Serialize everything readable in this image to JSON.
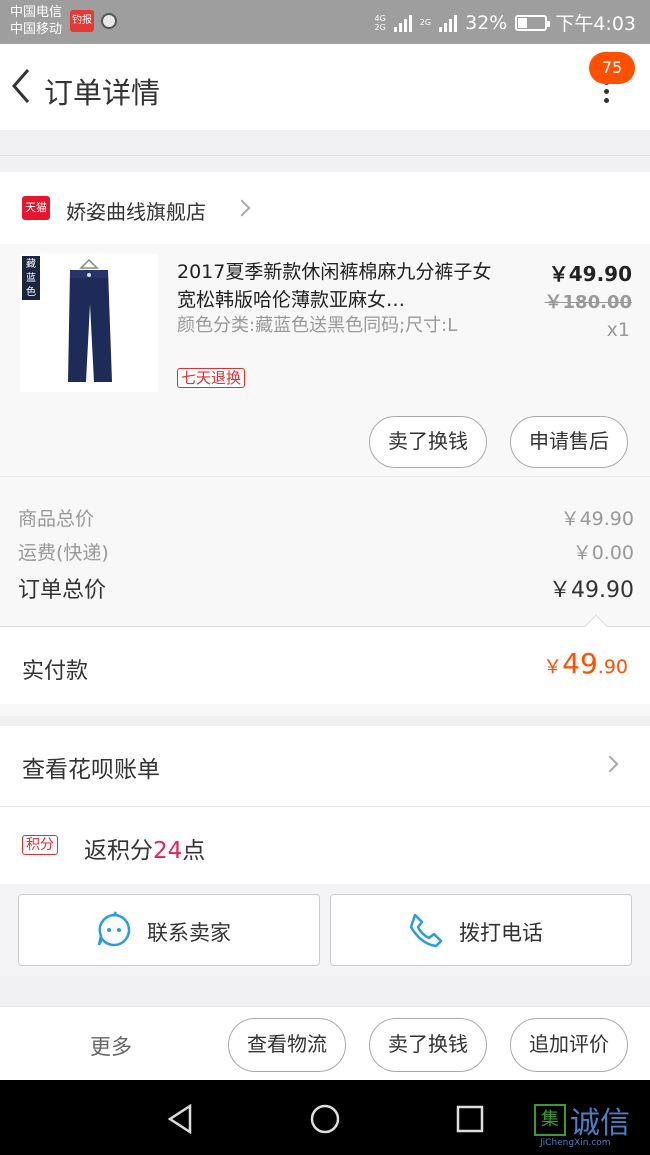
{
  "status_bar": {
    "carrier1": "中国电信",
    "carrier2": "中国移动",
    "app_icon_text": "钓报",
    "sig1_label_top": "4G",
    "sig1_label_bottom": "2G",
    "sig2_label": "2G",
    "battery": "32%",
    "time": "下午4:03"
  },
  "header": {
    "title": "订单详情",
    "badge": "75"
  },
  "shop": {
    "badge_text": "天猫",
    "name": "娇姿曲线旗舰店"
  },
  "item": {
    "image_tag": "藏蓝色",
    "title": "2017夏季新款休闲裤棉麻九分裤子女宽松韩版哈伦薄款亚麻女…",
    "spec": "颜色分类:藏蓝色送黑色同码;尺寸:L",
    "service_tag": "七天退换",
    "price": "￥49.90",
    "original_price": "￥180.00",
    "quantity": "x1",
    "sell_button": "卖了换钱",
    "after_sale_button": "申请售后"
  },
  "summary": {
    "goods_label": "商品总价",
    "goods_value": "￥49.90",
    "shipping_label": "运费(快递)",
    "shipping_value": "￥0.00",
    "total_label": "订单总价",
    "total_value": "￥49.90",
    "paid_label": "实付款",
    "paid_currency": "￥",
    "paid_int": "49",
    "paid_dec": ".90"
  },
  "huabei": {
    "label": "查看花呗账单"
  },
  "points": {
    "tag": "积分",
    "prefix": "返积分",
    "value": "24",
    "suffix": "点"
  },
  "contact": {
    "seller_label": "联系卖家",
    "phone_label": "拨打电话"
  },
  "actions": {
    "more_label": "更多",
    "logistics_button": "查看物流",
    "sell_button": "卖了换钱",
    "review_button": "追加评价"
  },
  "watermark": {
    "box_char": "集",
    "text": "诚信",
    "url": "JiChengXin.com"
  }
}
